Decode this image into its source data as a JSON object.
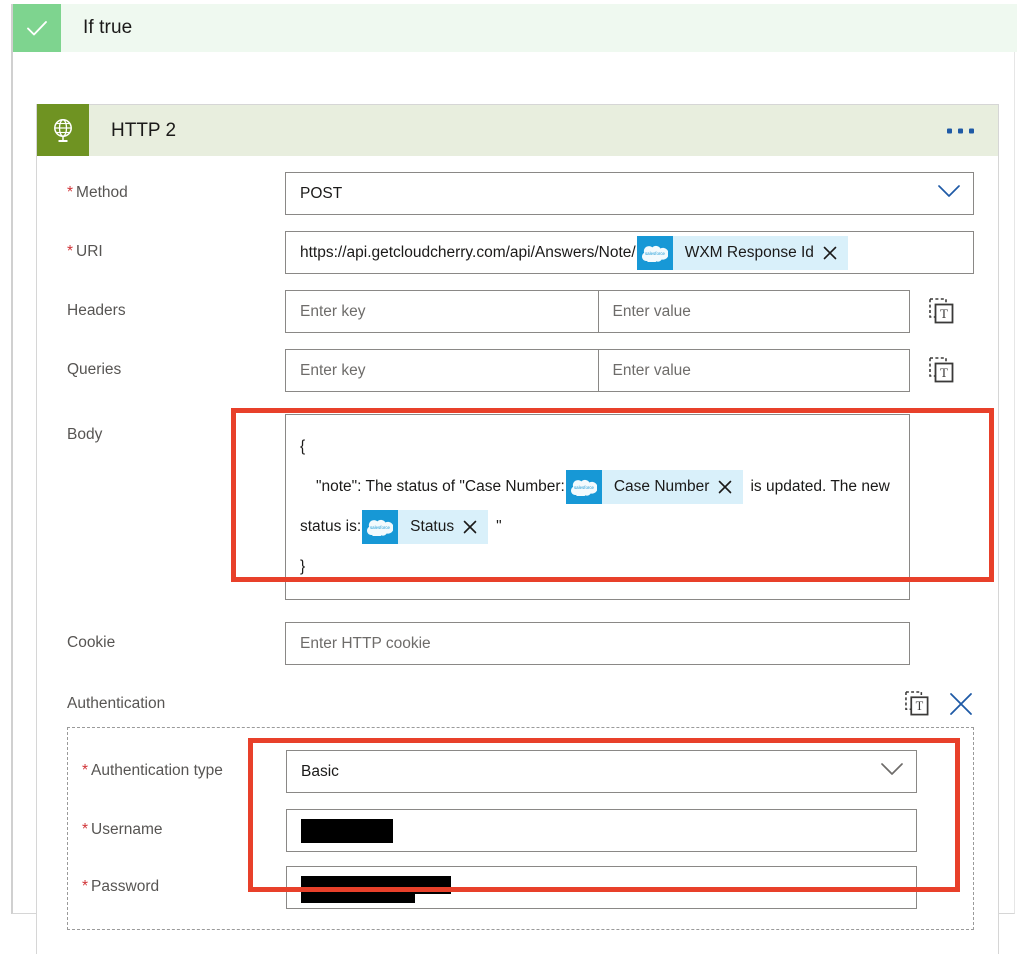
{
  "scope": {
    "title": "If true",
    "status_icon": "checkmark-icon"
  },
  "action_card": {
    "title": "HTTP 2",
    "icon": "globe-http-icon",
    "overflow_menu": "…"
  },
  "fields": {
    "method": {
      "label": "Method",
      "required": true,
      "value": "POST",
      "dropdown_icon": "chevron-down-icon"
    },
    "uri": {
      "label": "URI",
      "required": true,
      "text": "https://api.getcloudcherry.com/api/Answers/Note/",
      "token": {
        "label": "WXM Response Id",
        "source_icon": "salesforce-icon",
        "remove_icon": "close-icon"
      }
    },
    "headers": {
      "label": "Headers",
      "required": false,
      "key_placeholder": "Enter key",
      "value_placeholder": "Enter value",
      "switch_icon": "text-mode-icon"
    },
    "queries": {
      "label": "Queries",
      "required": false,
      "key_placeholder": "Enter key",
      "value_placeholder": "Enter value",
      "switch_icon": "text-mode-icon"
    },
    "body": {
      "label": "Body",
      "required": false,
      "line1": "{",
      "line2_a": "\"note\": The status of \"Case Number:",
      "token1": {
        "label": "Case Number",
        "source_icon": "salesforce-icon",
        "remove_icon": "close-icon"
      },
      "line2_b": "is updated. The new status is:",
      "token2": {
        "label": "Status",
        "source_icon": "salesforce-icon",
        "remove_icon": "close-icon"
      },
      "line3_quote": "\"",
      "line4": "}"
    },
    "cookie": {
      "label": "Cookie",
      "required": false,
      "placeholder": "Enter HTTP cookie"
    }
  },
  "authentication": {
    "label": "Authentication",
    "switch_icon": "text-mode-icon",
    "remove_icon": "close-icon",
    "type": {
      "label": "Authentication type",
      "required": true,
      "value": "Basic",
      "dropdown_icon": "chevron-down-icon"
    },
    "username": {
      "label": "Username",
      "required": true,
      "value": "",
      "redacted": true
    },
    "password": {
      "label": "Password",
      "required": true,
      "value": "",
      "redacted": true
    }
  },
  "annotations": {
    "highlight_color": "#e8402a",
    "boxes": [
      {
        "name": "body-highlight"
      },
      {
        "name": "credentials-highlight"
      }
    ]
  },
  "colors": {
    "scope_green": "#7ed48f",
    "scope_bg": "#eff9f0",
    "card_header": "#e8eede",
    "card_icon": "#6f9322",
    "token_logo": "#1798d6",
    "token_bg": "#d9f0fa",
    "required_red": "#d13438",
    "accent_blue": "#1f5aa6"
  }
}
